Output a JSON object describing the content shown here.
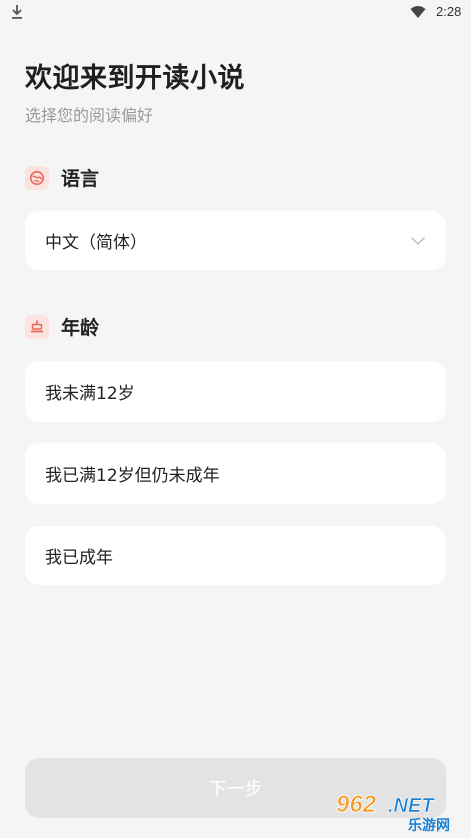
{
  "status_bar": {
    "time": "2:28"
  },
  "header": {
    "title": "欢迎来到开读小说",
    "subtitle": "选择您的阅读偏好"
  },
  "language_section": {
    "label": "语言",
    "selected_value": "中文（简体）"
  },
  "age_section": {
    "label": "年龄",
    "options": [
      "我未满12岁",
      "我已满12岁但仍未成年",
      "我已成年"
    ]
  },
  "next_button": {
    "label": "下一步"
  },
  "watermark": {
    "text_main": "962.NET",
    "text_sub": "乐游网"
  },
  "colors": {
    "background": "#f5f5f5",
    "card": "#ffffff",
    "icon_bg": "#fbe3e0",
    "icon_accent": "#e8675a",
    "button_disabled": "#e3e3e3",
    "subtitle": "#9a9a9a"
  },
  "icons": {
    "status_left": "download-icon",
    "status_right": "wifi-icon",
    "language": "globe-icon",
    "age": "cake-icon",
    "dropdown": "chevron-down-icon"
  }
}
